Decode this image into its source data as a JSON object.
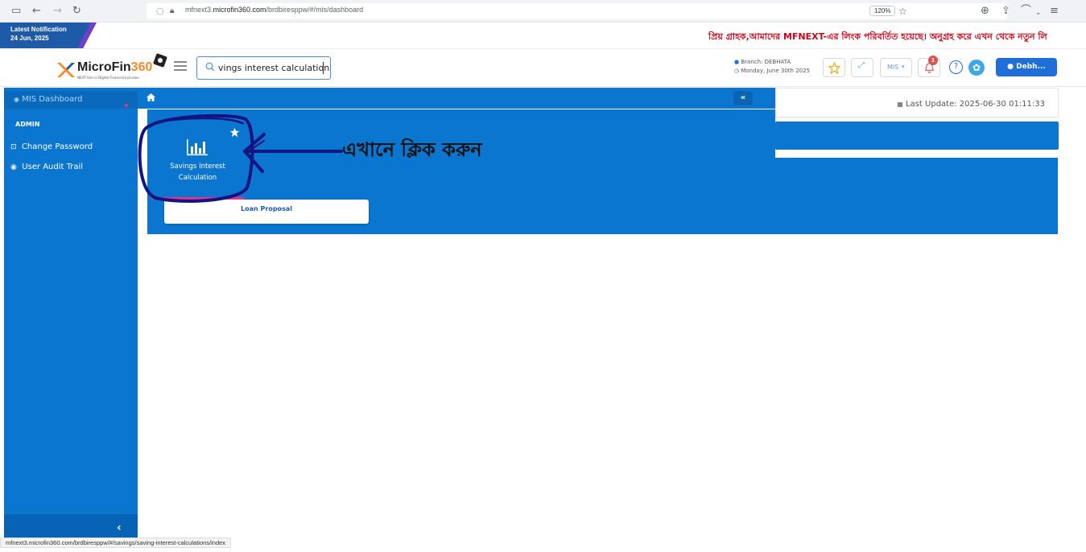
{
  "browser": {
    "url_prefix": "mfnext3.",
    "url_domain": "microfin360.com",
    "url_path": "/brdbiresppw/#/mis/dashboard",
    "zoom": "120%"
  },
  "notification": {
    "title": "Latest Notification",
    "date": "24 Jun, 2025",
    "marquee": "প্রিয় গ্রাহক,আমাদের MFNEXT-এর লিংক পরিবর্তিত হয়েছে। অনুগ্রহ করে এখন থেকে নতুন লি"
  },
  "header": {
    "logo_main": "MicroFin",
    "logo_accent": "360",
    "logo_sub": "NEXT-Gen in Digital Financial Inclusion",
    "search_value": "vings interest calculation",
    "branch": "Branch: DEBHATA",
    "date": "Monday, June 30th 2025",
    "mis_label": "MIS",
    "notif_count": "1",
    "user_label": "Debh...",
    "colors": {
      "primary": "#0b76d0",
      "accent": "#e0338b",
      "brand_orange": "#f28c28"
    }
  },
  "sidebar": {
    "active": "MIS Dashboard",
    "section": "ADMIN",
    "items": [
      {
        "label": "Change Password",
        "icon": "lock-icon"
      },
      {
        "label": "User Audit Trail",
        "icon": "eye-icon"
      }
    ]
  },
  "content": {
    "last_update": "Last Update: 2025-06-30 01:11:33",
    "cards": [
      {
        "label_line1": "Savings Interest",
        "label_line2": "Calculation",
        "icon": "bar-chart-icon",
        "favorite": true
      },
      {
        "label": "Loan Proposal"
      }
    ],
    "annotation": "এখানে ক্লিক করুন"
  },
  "status_bar": {
    "url": "mfnext3.microfin360.com/brdbiresppw/#/savings/saving-interest-calculations/index"
  }
}
